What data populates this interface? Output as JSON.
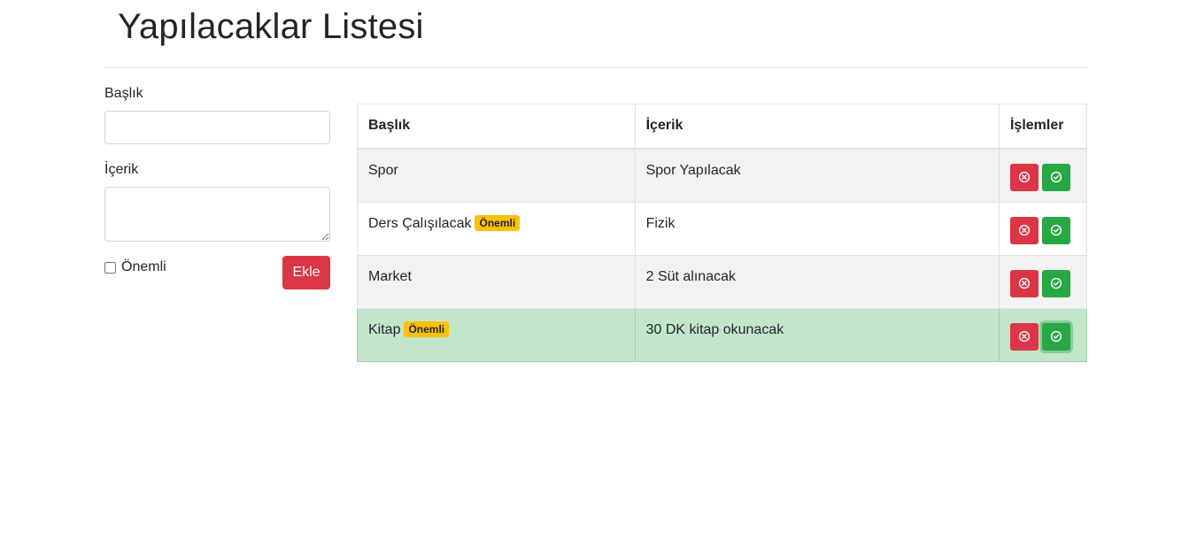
{
  "header": {
    "title": "Yapılacaklar Listesi"
  },
  "form": {
    "title_label": "Başlık",
    "title_value": "",
    "content_label": "İçerik",
    "content_value": "",
    "important_label": "Önemli",
    "important_checked": false,
    "add_button": "Ekle"
  },
  "table": {
    "headers": [
      "Başlık",
      "İçerik",
      "İşlemler"
    ],
    "rows": [
      {
        "title": "Spor",
        "badge": "",
        "content": "Spor Yapılacak"
      },
      {
        "title": "Ders Çalışılacak",
        "badge": "Önemli",
        "content": "Fizik"
      },
      {
        "title": "Market",
        "badge": "",
        "content": "2 Süt alınacak"
      },
      {
        "title": "Kitap",
        "badge": "Önemli",
        "content": "30 DK kitap okunacak",
        "completed": true
      }
    ]
  },
  "colors": {
    "danger": "#dc3545",
    "success": "#28a745",
    "warning": "#ffc107",
    "completed_row": "#c3e6cb"
  },
  "icons": {
    "delete": "x-circle-icon",
    "complete": "check-circle-icon"
  }
}
